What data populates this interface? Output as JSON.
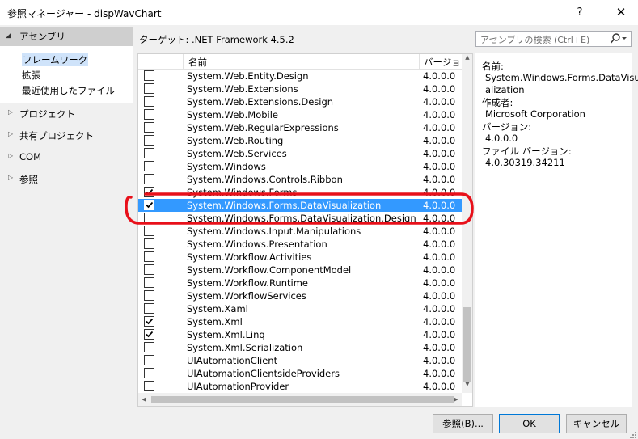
{
  "window": {
    "title": "参照マネージャー - dispWavChart",
    "help_glyph": "?",
    "close_glyph": "✕"
  },
  "nav": {
    "assembly": "アセンブリ",
    "sub_items": [
      "フレームワーク",
      "拡張",
      "最近使用したファイル"
    ],
    "items": [
      "プロジェクト",
      "共有プロジェクト",
      "COM",
      "参照"
    ]
  },
  "target_label": "ターゲット: .NET Framework 4.5.2",
  "search": {
    "placeholder": "アセンブリの検索 (Ctrl+E)"
  },
  "list": {
    "headers": {
      "name": "名前",
      "version": "バージョン"
    },
    "rows": [
      {
        "name": "System.Web.Entity.Design",
        "version": "4.0.0.0",
        "checked": false
      },
      {
        "name": "System.Web.Extensions",
        "version": "4.0.0.0",
        "checked": false
      },
      {
        "name": "System.Web.Extensions.Design",
        "version": "4.0.0.0",
        "checked": false
      },
      {
        "name": "System.Web.Mobile",
        "version": "4.0.0.0",
        "checked": false
      },
      {
        "name": "System.Web.RegularExpressions",
        "version": "4.0.0.0",
        "checked": false
      },
      {
        "name": "System.Web.Routing",
        "version": "4.0.0.0",
        "checked": false
      },
      {
        "name": "System.Web.Services",
        "version": "4.0.0.0",
        "checked": false
      },
      {
        "name": "System.Windows",
        "version": "4.0.0.0",
        "checked": false
      },
      {
        "name": "System.Windows.Controls.Ribbon",
        "version": "4.0.0.0",
        "checked": false
      },
      {
        "name": "System.Windows.Forms",
        "version": "4.0.0.0",
        "checked": true
      },
      {
        "name": "System.Windows.Forms.DataVisualization",
        "version": "4.0.0.0",
        "checked": true,
        "selected": true
      },
      {
        "name": "System.Windows.Forms.DataVisualization.Design",
        "version": "4.0.0.0",
        "checked": false
      },
      {
        "name": "System.Windows.Input.Manipulations",
        "version": "4.0.0.0",
        "checked": false
      },
      {
        "name": "System.Windows.Presentation",
        "version": "4.0.0.0",
        "checked": false
      },
      {
        "name": "System.Workflow.Activities",
        "version": "4.0.0.0",
        "checked": false
      },
      {
        "name": "System.Workflow.ComponentModel",
        "version": "4.0.0.0",
        "checked": false
      },
      {
        "name": "System.Workflow.Runtime",
        "version": "4.0.0.0",
        "checked": false
      },
      {
        "name": "System.WorkflowServices",
        "version": "4.0.0.0",
        "checked": false
      },
      {
        "name": "System.Xaml",
        "version": "4.0.0.0",
        "checked": false
      },
      {
        "name": "System.Xml",
        "version": "4.0.0.0",
        "checked": true
      },
      {
        "name": "System.Xml.Linq",
        "version": "4.0.0.0",
        "checked": true
      },
      {
        "name": "System.Xml.Serialization",
        "version": "4.0.0.0",
        "checked": false
      },
      {
        "name": "UIAutomationClient",
        "version": "4.0.0.0",
        "checked": false
      },
      {
        "name": "UIAutomationClientsideProviders",
        "version": "4.0.0.0",
        "checked": false
      },
      {
        "name": "UIAutomationProvider",
        "version": "4.0.0.0",
        "checked": false
      }
    ]
  },
  "detail": {
    "name_label": "名前:",
    "name_value_1": "System.Windows.Forms.DataVisu",
    "name_value_2": "alization",
    "author_label": "作成者:",
    "author_value": "Microsoft Corporation",
    "version_label": "バージョン:",
    "version_value": "4.0.0.0",
    "file_version_label": "ファイル バージョン:",
    "file_version_value": "4.0.30319.34211"
  },
  "buttons": {
    "browse": "参照(B)...",
    "ok": "OK",
    "cancel": "キャンセル"
  },
  "colors": {
    "selection": "#3399ff",
    "annotation": "#e8101a",
    "nav_selected": "#cfcfcf"
  }
}
